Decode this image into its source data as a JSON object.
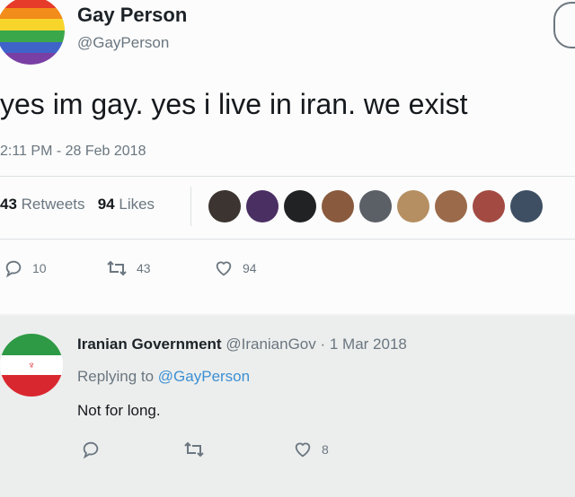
{
  "tweet": {
    "display_name": "Gay Person",
    "handle": "@GayPerson",
    "text": "yes im gay. yes i live in iran. we exist",
    "timestamp": "2:11 PM - 28 Feb 2018",
    "retweet_count": "43",
    "retweet_label": "Retweets",
    "like_count": "94",
    "like_label": "Likes",
    "avatar_icon": "rainbow-flag-avatar",
    "liker_avatar_colors": [
      "#3b3430",
      "#4a2f63",
      "#202224",
      "#8a5a3e",
      "#5b5f66",
      "#b58e62",
      "#9b6a4a",
      "#a34b43",
      "#3f4f63"
    ],
    "actions": {
      "reply_count": "10",
      "retweet_count": "43",
      "like_count": "94"
    }
  },
  "reply": {
    "display_name": "Iranian Government",
    "handle": "@IranianGov",
    "date": "· 1 Mar 2018",
    "replying_prefix": "Replying to",
    "replying_to": "@GayPerson",
    "text": "Not for long.",
    "avatar_icon": "iran-flag-avatar",
    "actions": {
      "like_count": "8"
    }
  }
}
